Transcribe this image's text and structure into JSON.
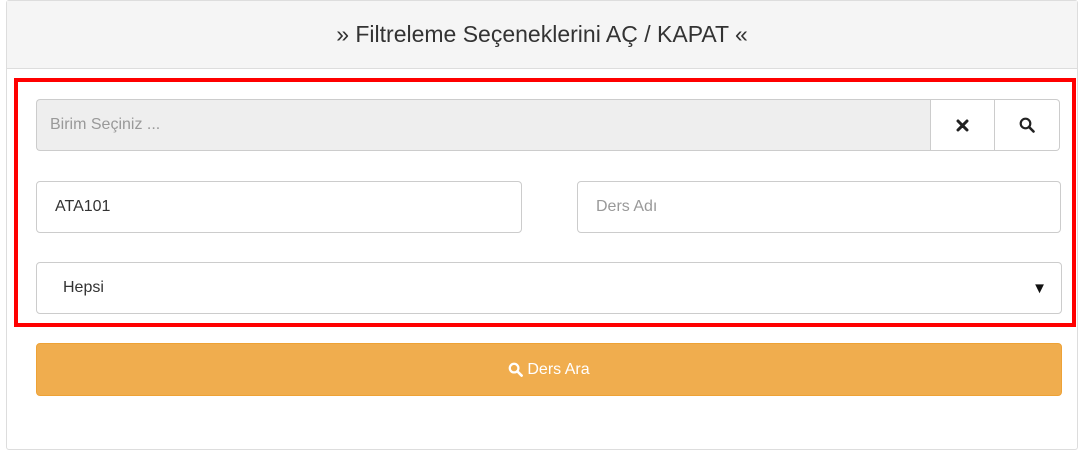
{
  "filter_panel": {
    "toggle_label": "» Filtreleme Seçeneklerini AÇ / KAPAT «",
    "unit": {
      "placeholder": "Birim Seçiniz ...",
      "clear_icon": "close-icon",
      "search_icon": "search-icon"
    },
    "course_code": {
      "value": "ATA101",
      "placeholder": ""
    },
    "course_name": {
      "value": "",
      "placeholder": "Ders Adı"
    },
    "type_select": {
      "selected": "Hepsi",
      "caret_icon": "caret-down-icon"
    },
    "search_button": {
      "label": "Ders Ara",
      "icon": "search-icon",
      "color": "#f0ad4e"
    },
    "highlight_color": "#ff0000"
  }
}
